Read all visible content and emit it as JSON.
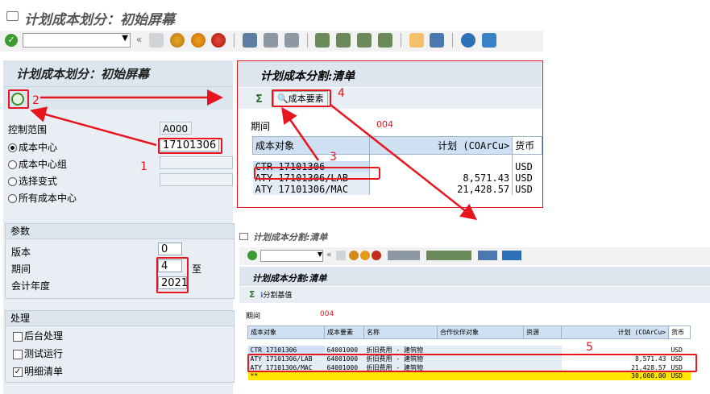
{
  "window_title": "计划成本划分：初始屏幕",
  "left_panel": {
    "header": "计划成本划分：初始屏幕",
    "controlling_area_label": "控制范围",
    "controlling_area_value": "A000",
    "cost_center_label": "成本中心",
    "cost_center_value": "17101306",
    "cost_center_group_label": "成本中心组",
    "variant_label": "选择变式",
    "all_cost_centers_label": "所有成本中心",
    "params_header": "参数",
    "version_label": "版本",
    "version_value": "0",
    "period_label": "期间",
    "period_value": "4",
    "period_to_label": "至",
    "fiscal_year_label": "会计年度",
    "fiscal_year_value": "2021",
    "processing_header": "处理",
    "background_label": "后台处理",
    "test_run_label": "测试运行",
    "detail_list_label": "明细清单"
  },
  "popup1": {
    "header": "计划成本分割:清单",
    "cost_element_button": "成本要素",
    "period_label": "期间",
    "period_value": "004",
    "columns": [
      "成本对象",
      "计划 (COArCu>",
      "货币"
    ],
    "rows": [
      {
        "object": "CTR 17101306",
        "plan": "",
        "currency": "USD"
      },
      {
        "object": "ATY 17101306/LAB",
        "plan": "8,571.43",
        "currency": "USD"
      },
      {
        "object": "ATY 17101306/MAC",
        "plan": "21,428.57",
        "currency": "USD"
      }
    ]
  },
  "popup2": {
    "window_title": "计划成本分割:清单",
    "header": "计划成本分割:清单",
    "button_label": "分割基值",
    "period_label": "期间",
    "period_value": "004",
    "columns": [
      "成本对象",
      "成本要素",
      "名称",
      "合作伙伴对象",
      "资源",
      "计划 (COArCu>",
      "货币"
    ],
    "rows": [
      {
        "object": "CTR 17101306",
        "element": "64001000",
        "name": "折旧费用 - 建筑物",
        "partner": "",
        "resource": "",
        "plan": "",
        "currency": "USD"
      },
      {
        "object": "ATY 17101306/LAB",
        "element": "64001000",
        "name": "折旧费用 - 建筑物",
        "partner": "",
        "resource": "",
        "plan": "8,571.43",
        "currency": "USD"
      },
      {
        "object": "ATY 17101306/MAC",
        "element": "64001000",
        "name": "折旧费用 - 建筑物",
        "partner": "",
        "resource": "",
        "plan": "21,428.57",
        "currency": "USD"
      }
    ],
    "total": {
      "marker": "**",
      "plan": "30,000.00",
      "currency": "USD"
    }
  },
  "annotations": [
    "1",
    "2",
    "3",
    "4",
    "5"
  ],
  "colors": {
    "annotation": "#e8141e",
    "sap_blue": "#cfe0f3",
    "total_row": "#ffe600"
  }
}
